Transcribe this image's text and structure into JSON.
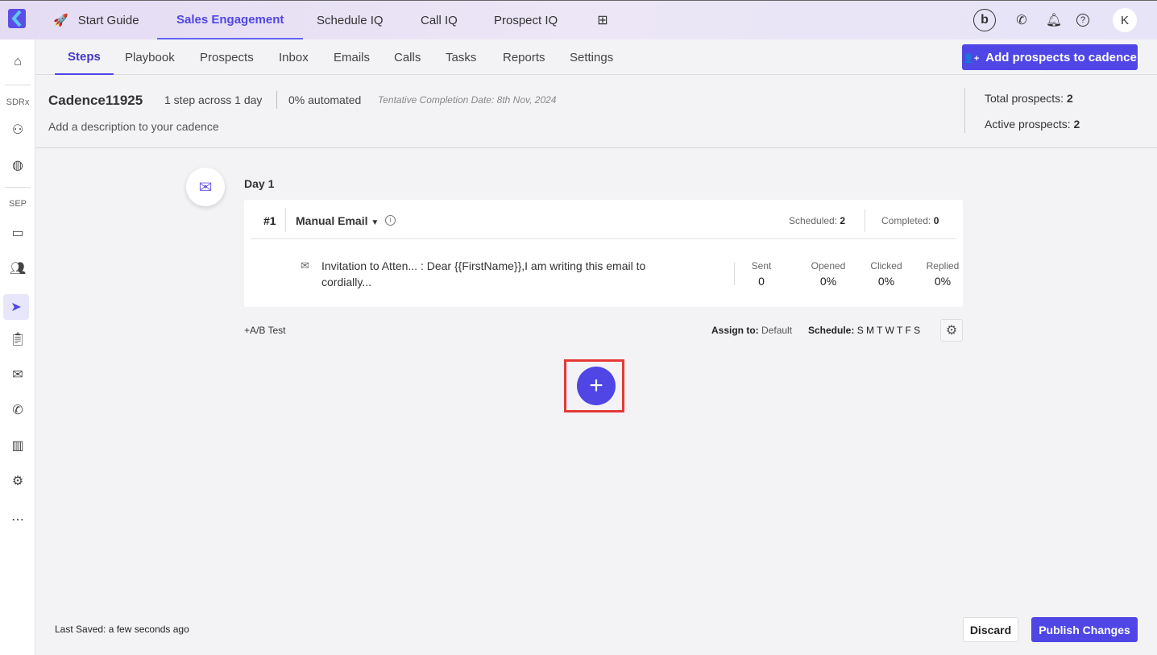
{
  "topnav": {
    "items": [
      "Start Guide",
      "Sales Engagement",
      "Schedule IQ",
      "Call IQ",
      "Prospect IQ"
    ],
    "avatar": "K"
  },
  "sidebar": {
    "sdrx": "SDRx",
    "sep": "SEP"
  },
  "subnav": {
    "tabs": [
      "Steps",
      "Playbook",
      "Prospects",
      "Inbox",
      "Emails",
      "Calls",
      "Tasks",
      "Reports",
      "Settings"
    ],
    "add_button": "Add prospects to cadence"
  },
  "cadence": {
    "name": "Cadence11925",
    "steps": "1 step across 1 day",
    "automated": "0% automated",
    "completion": "Tentative Completion Date: 8th Nov, 2024",
    "description": "Add a description to your cadence",
    "total_label": "Total prospects:",
    "total": "2",
    "active_label": "Active prospects:",
    "active": "2"
  },
  "day": {
    "label": "Day 1"
  },
  "step": {
    "number": "#1",
    "type": "Manual Email",
    "scheduled_label": "Scheduled:",
    "scheduled": "2",
    "completed_label": "Completed:",
    "completed": "0",
    "email_text": "Invitation to Atten... : Dear {{FirstName}},I am writing this email to cordially...",
    "stats": [
      {
        "label": "Sent",
        "value": "0"
      },
      {
        "label": "Opened",
        "value": "0%"
      },
      {
        "label": "Clicked",
        "value": "0%"
      },
      {
        "label": "Replied",
        "value": "0%"
      }
    ]
  },
  "footer_step": {
    "ab": "+A/B Test",
    "assign_label": "Assign to:",
    "assign": "Default",
    "schedule_label": "Schedule:",
    "schedule": "S M T W T F S"
  },
  "bottom": {
    "last_saved": "Last Saved: a few seconds ago",
    "discard": "Discard",
    "publish": "Publish Changes"
  },
  "colors": {
    "accent": "#4f46e5",
    "highlight": "#e53935"
  }
}
